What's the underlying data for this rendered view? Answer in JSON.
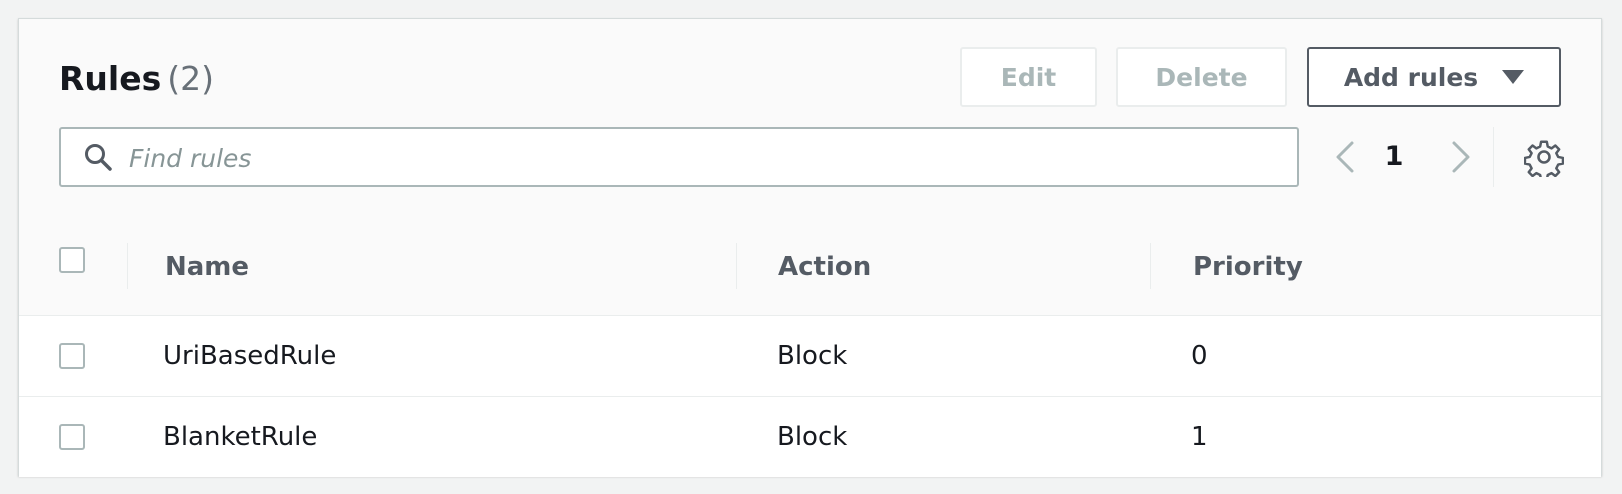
{
  "header": {
    "title": "Rules",
    "count": "(2)",
    "edit_label": "Edit",
    "delete_label": "Delete",
    "add_label": "Add rules"
  },
  "search": {
    "placeholder": "Find rules"
  },
  "pagination": {
    "current_page": "1"
  },
  "table": {
    "columns": [
      "Name",
      "Action",
      "Priority"
    ],
    "rows": [
      {
        "name": "UriBasedRule",
        "action": "Block",
        "priority": "0"
      },
      {
        "name": "BlanketRule",
        "action": "Block",
        "priority": "1"
      }
    ]
  },
  "colors": {
    "border": "#d5dbdb",
    "text": "#16191f",
    "muted": "#687078",
    "disabled": "#aab7b8",
    "button_border": "#545b64"
  },
  "icons": [
    "search-icon",
    "chevron-left-icon",
    "chevron-right-icon",
    "gear-icon",
    "caret-down-icon"
  ]
}
